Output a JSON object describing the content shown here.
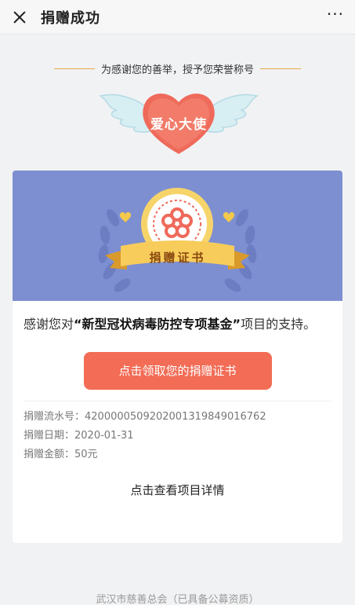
{
  "header": {
    "title": "捐赠成功",
    "more_label": "···"
  },
  "honor": {
    "caption": "为感谢您的善举，授予您荣誉称号",
    "title_badge": "爱心大使"
  },
  "certificate_banner": {
    "ribbon_text": "捐赠证书"
  },
  "thanks": {
    "prefix": "感谢您对",
    "fund_name": "“新型冠状病毒防控专项基金”",
    "suffix": "项目的支持。"
  },
  "button": {
    "label": "点击领取您的捐赠证书"
  },
  "donation": {
    "serial_label": "捐赠流水号：",
    "serial_value": "420000050920200131984901676​2",
    "date_label": "捐赠日期：",
    "date_value": "2020-01-31",
    "amount_label": "捐赠金额：",
    "amount_value": "50元"
  },
  "detail_link": "点击查看项目详情",
  "footer": "武汉市慈善总会（已具备公募资质）",
  "colors": {
    "accent": "#f26c56",
    "banner_bg": "#7d8fd1",
    "gold": "#e8a849"
  }
}
